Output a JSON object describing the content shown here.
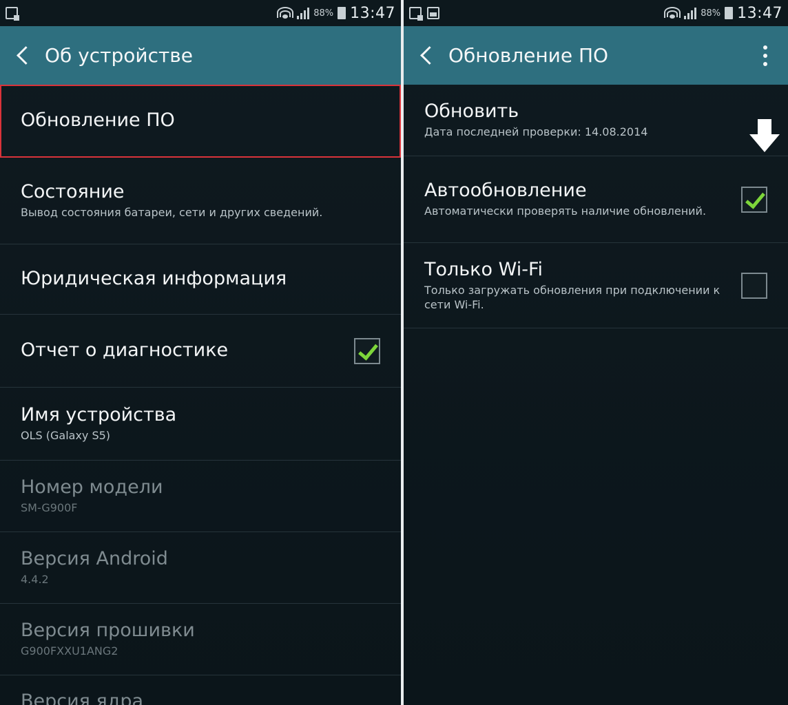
{
  "left": {
    "status": {
      "battery": "88%",
      "time": "13:47",
      "icons": [
        "notification-icon"
      ]
    },
    "header": {
      "title": "Об устройстве"
    },
    "items": [
      {
        "title": "Обновление ПО",
        "subtitle": ""
      },
      {
        "title": "Состояние",
        "subtitle": "Вывод состояния батареи, сети и других сведений."
      },
      {
        "title": "Юридическая информация",
        "subtitle": ""
      },
      {
        "title": "Отчет о диагностике",
        "subtitle": "",
        "checked": true
      },
      {
        "title": "Имя устройства",
        "subtitle": "OLS (Galaxy S5)"
      },
      {
        "title": "Номер модели",
        "subtitle": "SM-G900F"
      },
      {
        "title": "Версия Android",
        "subtitle": "4.4.2"
      },
      {
        "title": "Версия прошивки",
        "subtitle": "G900FXXU1ANG2"
      },
      {
        "title": "Версия ядра",
        "subtitle": ""
      }
    ]
  },
  "right": {
    "status": {
      "battery": "88%",
      "time": "13:47",
      "icons": [
        "notification-icon",
        "gallery-icon"
      ]
    },
    "header": {
      "title": "Обновление ПО"
    },
    "items": [
      {
        "title": "Обновить",
        "subtitle": "Дата последней проверки: 14.08.2014"
      },
      {
        "title": "Автообновление",
        "subtitle": "Автоматически проверять наличие обновлений.",
        "checked": true
      },
      {
        "title": "Только Wi-Fi",
        "subtitle": "Только загружать обновления при подключении к сети Wi-Fi.",
        "checked": false
      }
    ]
  },
  "colors": {
    "appbar": "#2e6f7f",
    "background": "#0b151a",
    "check": "#7dd63a",
    "selection": "#d9333a"
  }
}
